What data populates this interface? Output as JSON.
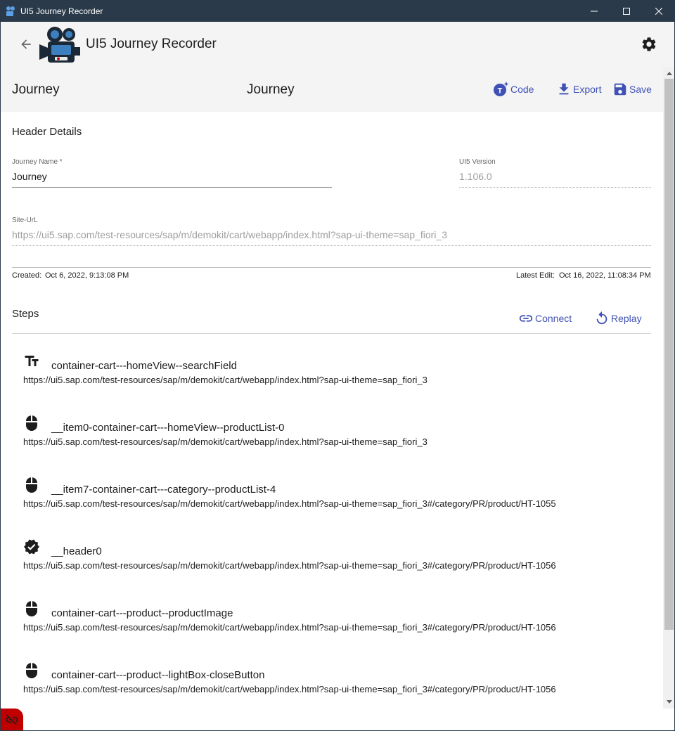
{
  "window": {
    "title": "UI5 Journey Recorder"
  },
  "header": {
    "title": "UI5 Journey Recorder"
  },
  "toolbar": {
    "left_title": "Journey",
    "center_title": "Journey",
    "code_label": "Code",
    "export_label": "Export",
    "save_label": "Save"
  },
  "details": {
    "section_title": "Header Details",
    "journey_name_label": "Journey Name *",
    "journey_name_value": "Journey",
    "ui5_version_label": "UI5 Version",
    "ui5_version_value": "1.106.0",
    "site_url_label": "Site-UrL",
    "site_url_value": "https://ui5.sap.com/test-resources/sap/m/demokit/cart/webapp/index.html?sap-ui-theme=sap_fiori_3",
    "created_label": "Created:",
    "created_value": "Oct 6, 2022, 9:13:08 PM",
    "latest_edit_label": "Latest Edit:",
    "latest_edit_value": "Oct 16, 2022, 11:08:34 PM"
  },
  "steps": {
    "section_title": "Steps",
    "connect_label": "Connect",
    "replay_label": "Replay",
    "items": [
      {
        "icon": "text-input-icon",
        "selector": "container-cart---homeView--searchField",
        "url": "https://ui5.sap.com/test-resources/sap/m/demokit/cart/webapp/index.html?sap-ui-theme=sap_fiori_3"
      },
      {
        "icon": "mouse-icon",
        "selector": "__item0-container-cart---homeView--productList-0",
        "url": "https://ui5.sap.com/test-resources/sap/m/demokit/cart/webapp/index.html?sap-ui-theme=sap_fiori_3"
      },
      {
        "icon": "mouse-icon",
        "selector": "__item7-container-cart---category--productList-4",
        "url": "https://ui5.sap.com/test-resources/sap/m/demokit/cart/webapp/index.html?sap-ui-theme=sap_fiori_3#/category/PR/product/HT-1055"
      },
      {
        "icon": "verified-badge-icon",
        "selector": "__header0",
        "url": "https://ui5.sap.com/test-resources/sap/m/demokit/cart/webapp/index.html?sap-ui-theme=sap_fiori_3#/category/PR/product/HT-1056"
      },
      {
        "icon": "mouse-icon",
        "selector": "container-cart---product--productImage",
        "url": "https://ui5.sap.com/test-resources/sap/m/demokit/cart/webapp/index.html?sap-ui-theme=sap_fiori_3#/category/PR/product/HT-1056"
      },
      {
        "icon": "mouse-icon",
        "selector": "container-cart---product--lightBox-closeButton",
        "url": "https://ui5.sap.com/test-resources/sap/m/demokit/cart/webapp/index.html?sap-ui-theme=sap_fiori_3#/category/PR/product/HT-1056"
      }
    ]
  },
  "colors": {
    "accent": "#3f51b5",
    "titlebar": "#2b3a4a",
    "disconnected": "#c00000"
  }
}
